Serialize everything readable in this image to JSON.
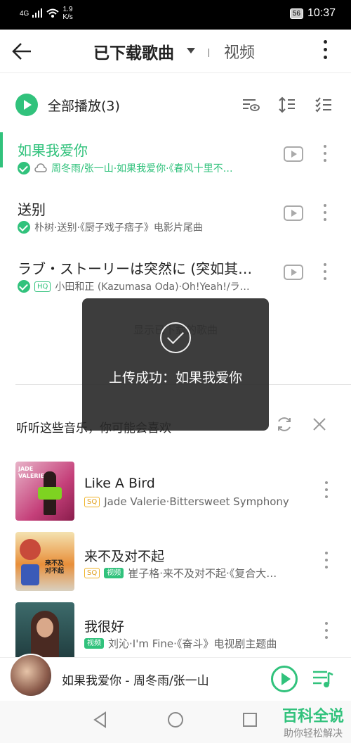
{
  "status": {
    "signal": "4G",
    "speed": "1.9",
    "speed_unit": "K/s",
    "battery": "56",
    "time": "10:37"
  },
  "header": {
    "title": "已下载歌曲",
    "tab_video": "视频"
  },
  "play_all": {
    "label": "全部播放(3)"
  },
  "songs": [
    {
      "name": "如果我爱你",
      "meta": "周冬雨/张一山·如果我爱你·《春风十里不…",
      "active": true
    },
    {
      "name": "送别",
      "meta": "朴树·送别·《厨子戏子痞子》电影片尾曲",
      "active": false
    },
    {
      "name": "ラブ・ストーリーは突然に (突如其…",
      "tag": "HQ",
      "meta": "小田和正 (Kazumasa Oda)·Oh!Yeah!/ラ…",
      "active": false
    }
  ],
  "show_downloaded": "显示已下载的歌曲",
  "recommend": {
    "title": "听听这些音乐，你可能会喜欢",
    "items": [
      {
        "name": "Like A Bird",
        "tags": [
          "SQ"
        ],
        "meta": "Jade Valerie·Bittersweet Symphony",
        "cover_text": "JADE VALERIE"
      },
      {
        "name": "来不及对不起",
        "tags": [
          "SQ",
          "视频"
        ],
        "meta": "崔子格·来不及对不起·《复合大…",
        "cover_text": "来不及 对不起"
      },
      {
        "name": "我很好",
        "tags": [
          "视频"
        ],
        "meta": "刘沁·I'm Fine·《奋斗》电视剧主题曲",
        "cover_text": ""
      }
    ]
  },
  "player": {
    "title": "如果我爱你 - 周冬雨/张一山"
  },
  "toast": {
    "message": "上传成功：如果我爱你"
  },
  "watermark": {
    "line1": "百科全说",
    "line2": "助你轻松解决"
  }
}
